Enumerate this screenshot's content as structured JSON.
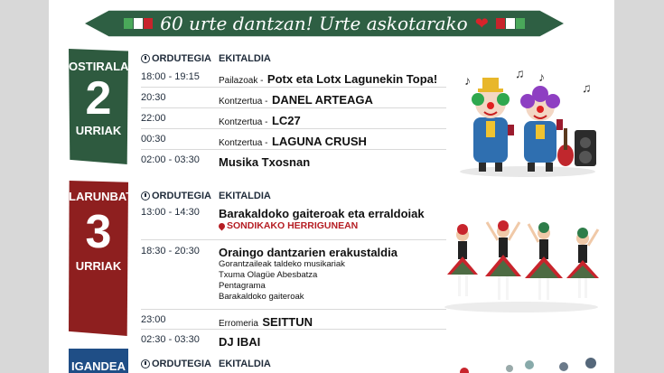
{
  "banner": {
    "title": "60 urte dantzan! Urte askotarako"
  },
  "days": [
    {
      "name": "OSTIRALA",
      "number": "2",
      "month": "URRIAK",
      "color": "#2e5a3f"
    },
    {
      "name": "LARUNBATA",
      "number": "3",
      "month": "URRIAK",
      "color": "#8e1f1f"
    },
    {
      "name": "IGANDEA",
      "color": "#1f4e86"
    }
  ],
  "headers": {
    "time": "ORDUTEGIA",
    "activity": "EKITALDIA"
  },
  "friday": [
    {
      "time": "18:00 - 19:15",
      "type": "Pailazoak -",
      "name": "Potx eta Lotx Lagunekin Topa!"
    },
    {
      "time": "20:30",
      "type": "Kontzertua -",
      "name": "DANEL ARTEAGA"
    },
    {
      "time": "22:00",
      "type": "Kontzertua -",
      "name": "LC27"
    },
    {
      "time": "00:30",
      "type": "Kontzertua -",
      "name": "LAGUNA CRUSH"
    },
    {
      "time": "02:00 - 03:30",
      "type": "",
      "name": "Musika Txosnan"
    }
  ],
  "saturday": {
    "r1": {
      "time": "13:00 - 14:30",
      "name": "Barakaldoko gaiteroak eta erraldoiak",
      "location": "SONDIKAKO HERRIGUNEAN"
    },
    "r2": {
      "time": "18:30 - 20:30",
      "name": "Oraingo dantzarien erakustaldia",
      "subs": [
        "Gorantzaileak taldeko musikariak",
        "Txuma Olagüe Abesbatza",
        "Pentagrama",
        "Barakaldoko gaiteroak"
      ]
    },
    "r3": {
      "time": "23:00",
      "type": "Erromeria",
      "name": "SEITTUN"
    },
    "r4": {
      "time": "02:30 - 03:30",
      "name": "DJ IBAI"
    }
  }
}
